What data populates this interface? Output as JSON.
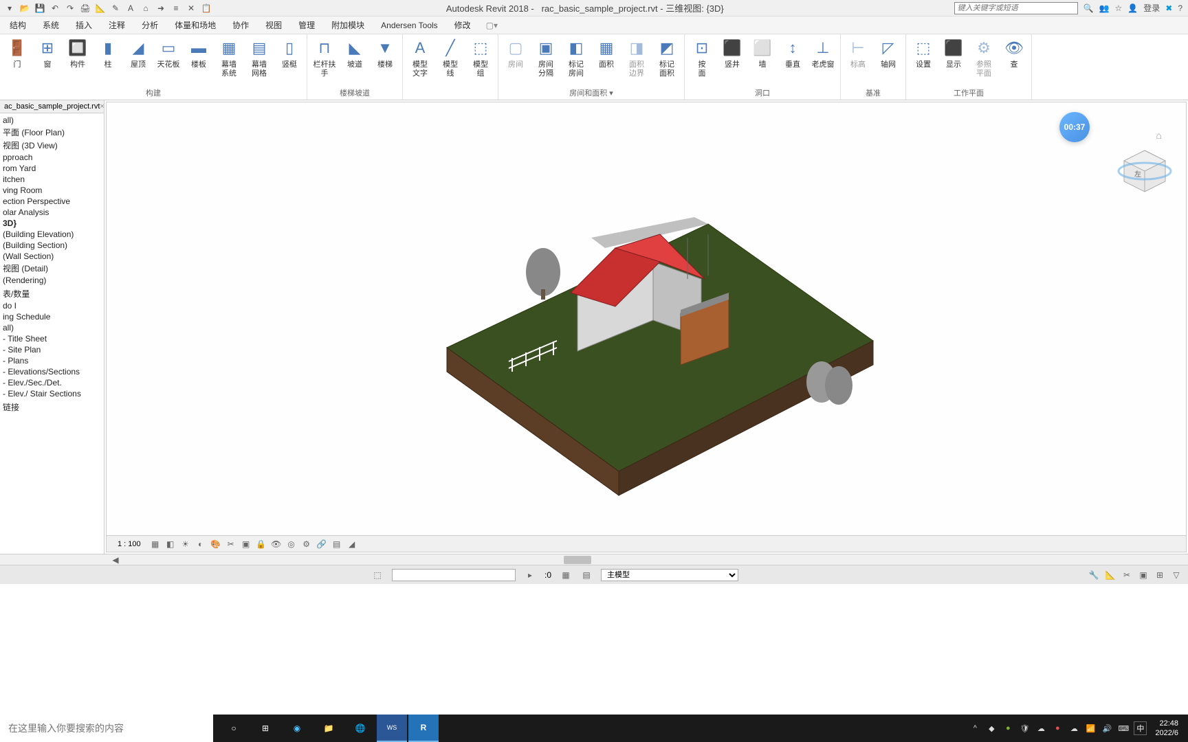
{
  "title": {
    "app": "Autodesk Revit 2018 -",
    "file": "rac_basic_sample_project.rvt - 三维视图: {3D}",
    "search_placeholder": "键入关键字或短语",
    "login": "登录"
  },
  "menu": {
    "items": [
      "结构",
      "系统",
      "插入",
      "注释",
      "分析",
      "体量和场地",
      "协作",
      "视图",
      "管理",
      "附加模块",
      "Andersen Tools",
      "修改"
    ]
  },
  "ribbon": {
    "groups": [
      {
        "label": "构建",
        "items": [
          {
            "label": "门"
          },
          {
            "label": "窗"
          },
          {
            "label": "构件"
          },
          {
            "label": "柱"
          },
          {
            "label": "屋顶"
          },
          {
            "label": "天花板"
          },
          {
            "label": "楼板"
          },
          {
            "label": "幕墙\n系统"
          },
          {
            "label": "幕墙\n网格"
          },
          {
            "label": "竖梃"
          }
        ]
      },
      {
        "label": "楼梯坡道",
        "items": [
          {
            "label": "栏杆扶手"
          },
          {
            "label": "坡道"
          },
          {
            "label": "楼梯"
          }
        ]
      },
      {
        "label": "",
        "items": [
          {
            "label": "模型\n文字"
          },
          {
            "label": "模型\n线"
          },
          {
            "label": "模型\n组"
          }
        ]
      },
      {
        "label": "房间和面积 ▾",
        "items": [
          {
            "label": "房间",
            "disabled": true
          },
          {
            "label": "房间\n分隔"
          },
          {
            "label": "标记\n房间"
          },
          {
            "label": "面积"
          },
          {
            "label": "面积\n边界",
            "disabled": true
          },
          {
            "label": "标记\n面积"
          }
        ]
      },
      {
        "label": "洞口",
        "items": [
          {
            "label": "按\n面"
          },
          {
            "label": "竖井"
          },
          {
            "label": "墙"
          },
          {
            "label": "垂直"
          },
          {
            "label": "老虎窗"
          }
        ]
      },
      {
        "label": "基准",
        "items": [
          {
            "label": "标高",
            "disabled": true
          },
          {
            "label": "轴网"
          }
        ]
      },
      {
        "label": "工作平面",
        "items": [
          {
            "label": "设置"
          },
          {
            "label": "显示"
          },
          {
            "label": "参照\n平面",
            "disabled": true
          },
          {
            "label": "查"
          }
        ]
      }
    ]
  },
  "browser": {
    "tab": "ac_basic_sample_project.rvt",
    "items": [
      "all)",
      "平面 (Floor Plan)",
      "视图 (3D View)",
      "pproach",
      "rom Yard",
      "itchen",
      "ving Room",
      "ection Perspective",
      "olar Analysis",
      "3D}",
      "(Building Elevation)",
      "(Building Section)",
      "(Wall Section)",
      "视图 (Detail)",
      "(Rendering)",
      "",
      "表/数量",
      "do I",
      "ing Schedule",
      "all)",
      " - Title Sheet",
      " - Site Plan",
      " - Plans",
      " - Elevations/Sections",
      " - Elev./Sec./Det.",
      " - Elev./ Stair Sections",
      "",
      "链接"
    ],
    "active_index": 9
  },
  "timer": "00:37",
  "view_controls": {
    "scale": "1 : 100"
  },
  "options_bar": {
    "offset_label": ":0",
    "view_mode": "主模型"
  },
  "taskbar": {
    "search_placeholder": "在这里输入你要搜索的内容",
    "ime": "中",
    "time": "22:48",
    "date": "2022/6"
  }
}
